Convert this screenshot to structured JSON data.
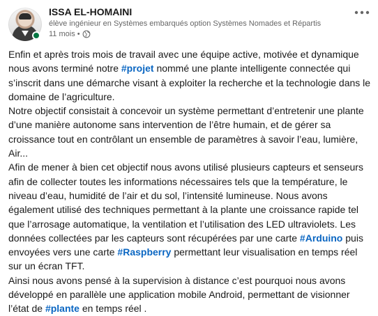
{
  "post": {
    "author": {
      "name": "ISSA EL-HOMAINI",
      "headline": "élève ingénieur en Systèmes embarqués option Systèmes Nomades et Répartis",
      "time": "11 mois",
      "separator": "•"
    },
    "menu_icon": "more-horizontal-icon",
    "visibility_icon": "globe-icon",
    "paragraphs": [
      [
        {
          "t": "Enfin et après trois mois de travail avec une équipe active, motivée et dynamique nous avons terminé notre "
        },
        {
          "t": "#projet",
          "tag": true
        },
        {
          "t": " nommé une plante intelligente connectée qui s’inscrit dans une démarche visant à exploiter la recherche et la technologie dans le domaine de l’agriculture."
        }
      ],
      [
        {
          "t": "Notre objectif consistait à concevoir un système permettant d’entretenir une plante d’une manière autonome sans intervention de l’être humain, et de gérer sa croissance tout en contrôlant un ensemble de paramètres à savoir l’eau, lumière, Air..."
        }
      ],
      [
        {
          "t": "Afin de mener à bien cet objectif nous avons utilisé plusieurs capteurs et senseurs afin de collecter toutes les informations nécessaires tels que la température, le niveau d’eau, humidité de l’air et du sol, l’intensité lumineuse. Nous avons également utilisé des techniques permettant à la plante une croissance rapide tel que l’arrosage automatique, la ventilation et l’utilisation des LED ultraviolets. Les données collectées par les capteurs sont récupérées par une carte "
        },
        {
          "t": "#Arduino",
          "tag": true
        },
        {
          "t": " puis envoyées vers une carte "
        },
        {
          "t": "#Raspberry",
          "tag": true
        },
        {
          "t": " permettant leur visualisation en temps réel sur un écran TFT."
        }
      ],
      [
        {
          "t": "Ainsi nous avons pensé à la supervision à distance c’est pourquoi nous avons développé en parallèle une application mobile Android, permettant de visionner l’état de "
        },
        {
          "t": "#plante",
          "tag": true
        },
        {
          "t": " en temps réel ."
        }
      ]
    ],
    "colors": {
      "hashtag": "#0a66c2",
      "presence": "#057642",
      "text": "#191919",
      "muted": "#666666"
    }
  }
}
